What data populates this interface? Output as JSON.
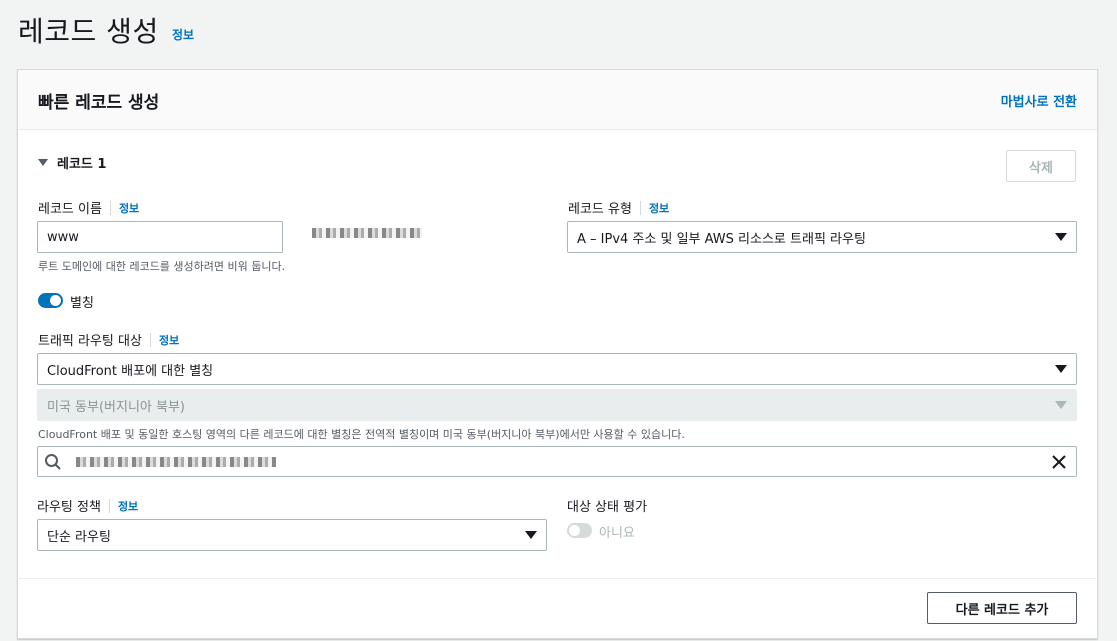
{
  "page": {
    "title": "레코드 생성",
    "info_label": "정보"
  },
  "panel": {
    "title": "빠른 레코드 생성",
    "wizard_link": "마법사로 전환",
    "record_label": "레코드 1",
    "delete_button": "삭제",
    "add_record_button": "다른 레코드 추가"
  },
  "record_name": {
    "label": "레코드 이름",
    "info": "정보",
    "value": "www",
    "hint": "루트 도메인에 대한 레코드를 생성하려면 비워 둡니다."
  },
  "record_type": {
    "label": "레코드 유형",
    "info": "정보",
    "value": "A – IPv4 주소 및 일부 AWS 리소스로 트래픽 라우팅"
  },
  "alias": {
    "label": "별칭",
    "enabled": true
  },
  "route_traffic": {
    "label": "트래픽 라우팅 대상",
    "info": "정보",
    "endpoint_value": "CloudFront 배포에 대한 별칭",
    "region_value": "미국 동부(버지니아 북부)",
    "hint": "CloudFront 배포 및 동일한 호스팅 영역의 다른 레코드에 대한 별칭은 전역적 별칭이며 미국 동부(버지니아 북부)에서만 사용할 수 있습니다."
  },
  "routing_policy": {
    "label": "라우팅 정책",
    "info": "정보",
    "value": "단순 라우팅"
  },
  "health": {
    "label": "대상 상태 평가",
    "value": "아니요",
    "enabled": false
  },
  "icons": {
    "search": "search-icon",
    "clear": "close-icon",
    "caret": "caret-down-icon",
    "dropdown": "chevron-down-icon"
  },
  "colors": {
    "link": "#0073bb",
    "toggle_on": "#0073bb",
    "background": "#f2f3f3"
  }
}
